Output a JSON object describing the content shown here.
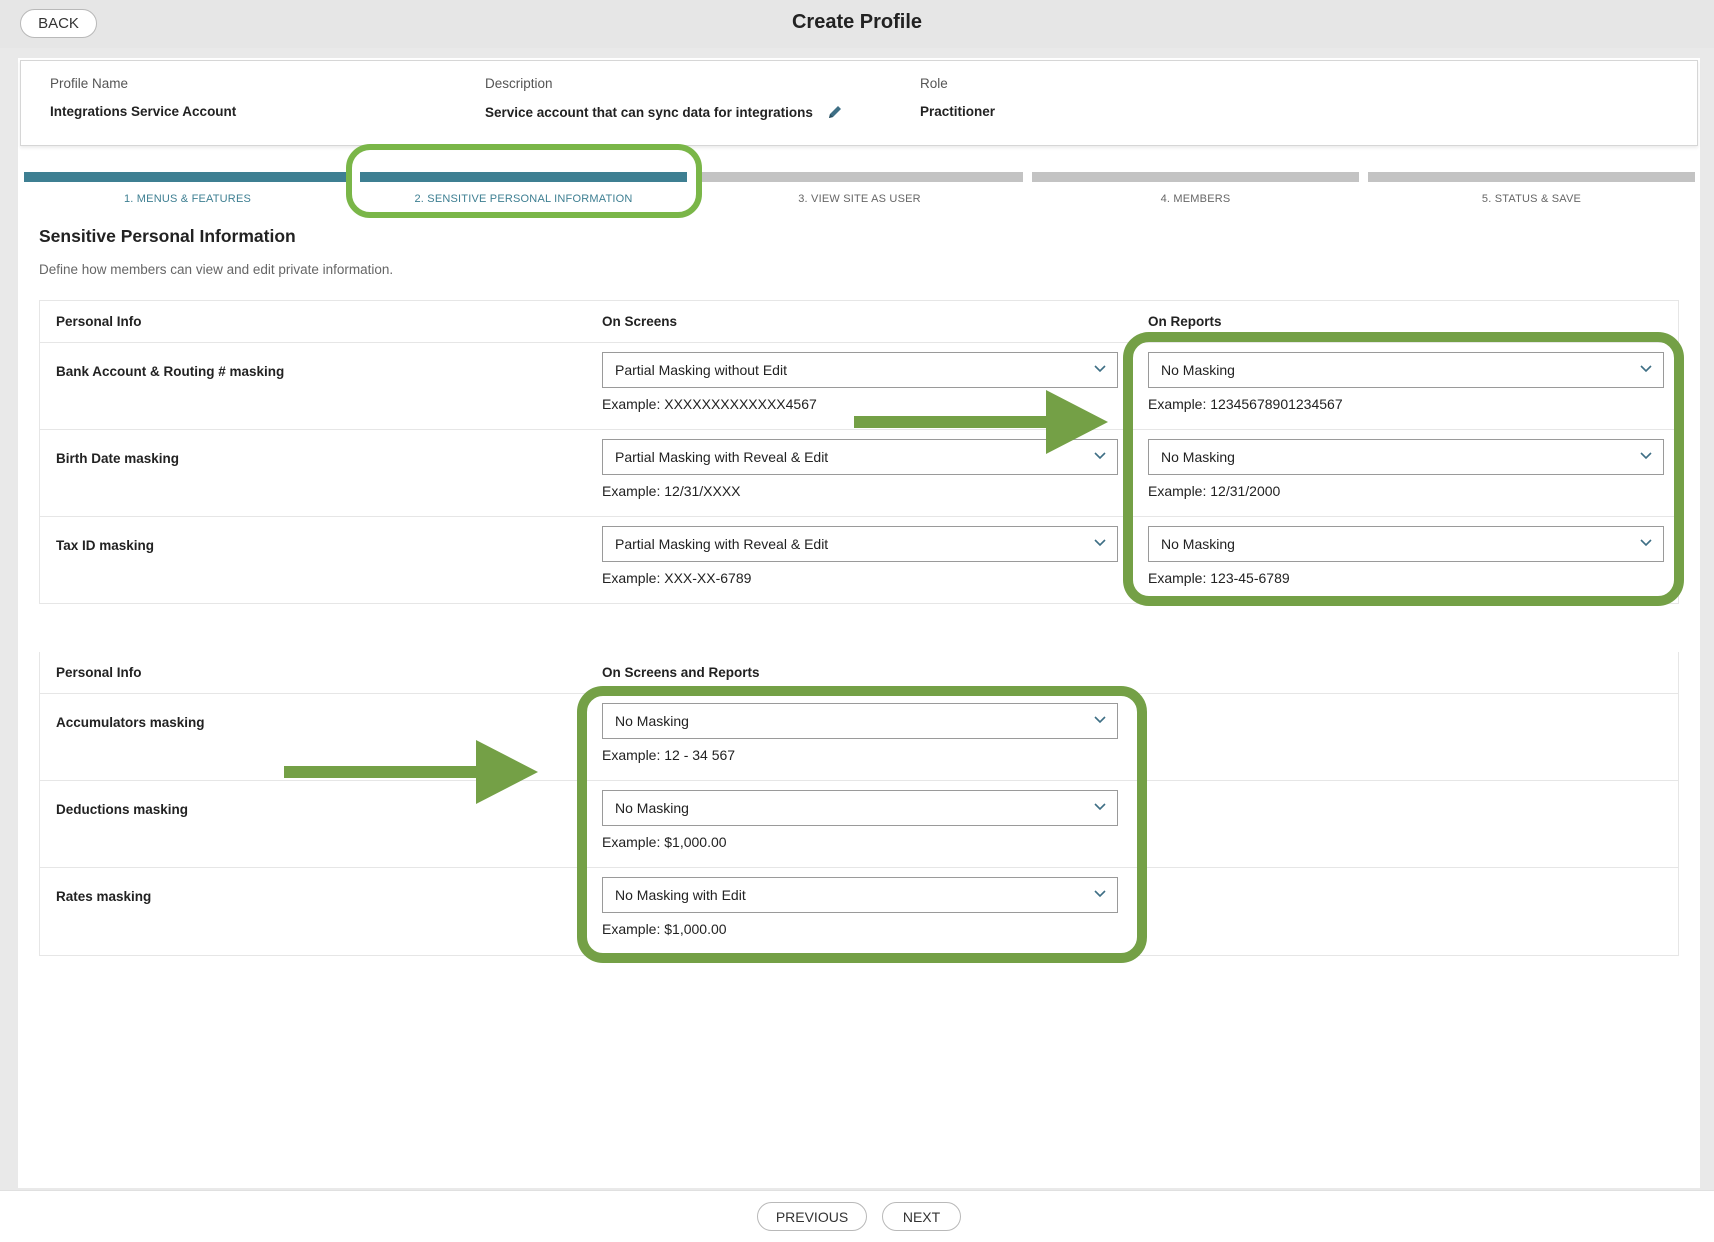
{
  "header": {
    "back_label": "BACK",
    "title": "Create Profile"
  },
  "profile": {
    "name_label": "Profile Name",
    "name_value": "Integrations Service Account",
    "desc_label": "Description",
    "desc_value": "Service account that can sync data for integrations",
    "role_label": "Role",
    "role_value": "Practitioner",
    "edit_icon": "pencil-icon"
  },
  "steps": [
    {
      "label": "1. MENUS & FEATURES",
      "state": "done"
    },
    {
      "label": "2. SENSITIVE PERSONAL INFORMATION",
      "state": "active"
    },
    {
      "label": "3. VIEW SITE AS USER",
      "state": "todo"
    },
    {
      "label": "4. MEMBERS",
      "state": "todo"
    },
    {
      "label": "5. STATUS & SAVE",
      "state": "todo"
    }
  ],
  "section": {
    "title": "Sensitive Personal Information",
    "description": "Define how members can view and edit private information."
  },
  "table1": {
    "headers": [
      "Personal Info",
      "On Screens",
      "On Reports"
    ],
    "rows": [
      {
        "label": "Bank Account & Routing # masking",
        "screens_value": "Partial Masking without Edit",
        "screens_example": "Example: XXXXXXXXXXXXX4567",
        "reports_value": "No Masking",
        "reports_example": "Example: 12345678901234567"
      },
      {
        "label": "Birth Date masking",
        "screens_value": "Partial Masking with Reveal & Edit",
        "screens_example": "Example: 12/31/XXXX",
        "reports_value": "No Masking",
        "reports_example": "Example: 12/31/2000"
      },
      {
        "label": "Tax ID masking",
        "screens_value": "Partial Masking with Reveal & Edit",
        "screens_example": "Example: XXX-XX-6789",
        "reports_value": "No Masking",
        "reports_example": "Example: 123-45-6789"
      }
    ]
  },
  "table2": {
    "headers": [
      "Personal Info",
      "On Screens and Reports"
    ],
    "rows": [
      {
        "label": "Accumulators masking",
        "value": "No Masking",
        "example": "Example: 12 - 34 567"
      },
      {
        "label": "Deductions masking",
        "value": "No Masking",
        "example": "Example: $1,000.00"
      },
      {
        "label": "Rates masking",
        "value": "No Masking with Edit",
        "example": "Example: $1,000.00"
      }
    ]
  },
  "footer": {
    "previous_label": "PREVIOUS",
    "next_label": "NEXT"
  },
  "colors": {
    "accent": "#3e7f92",
    "highlight": "#74a046",
    "step_inactive": "#c3c3c3"
  }
}
